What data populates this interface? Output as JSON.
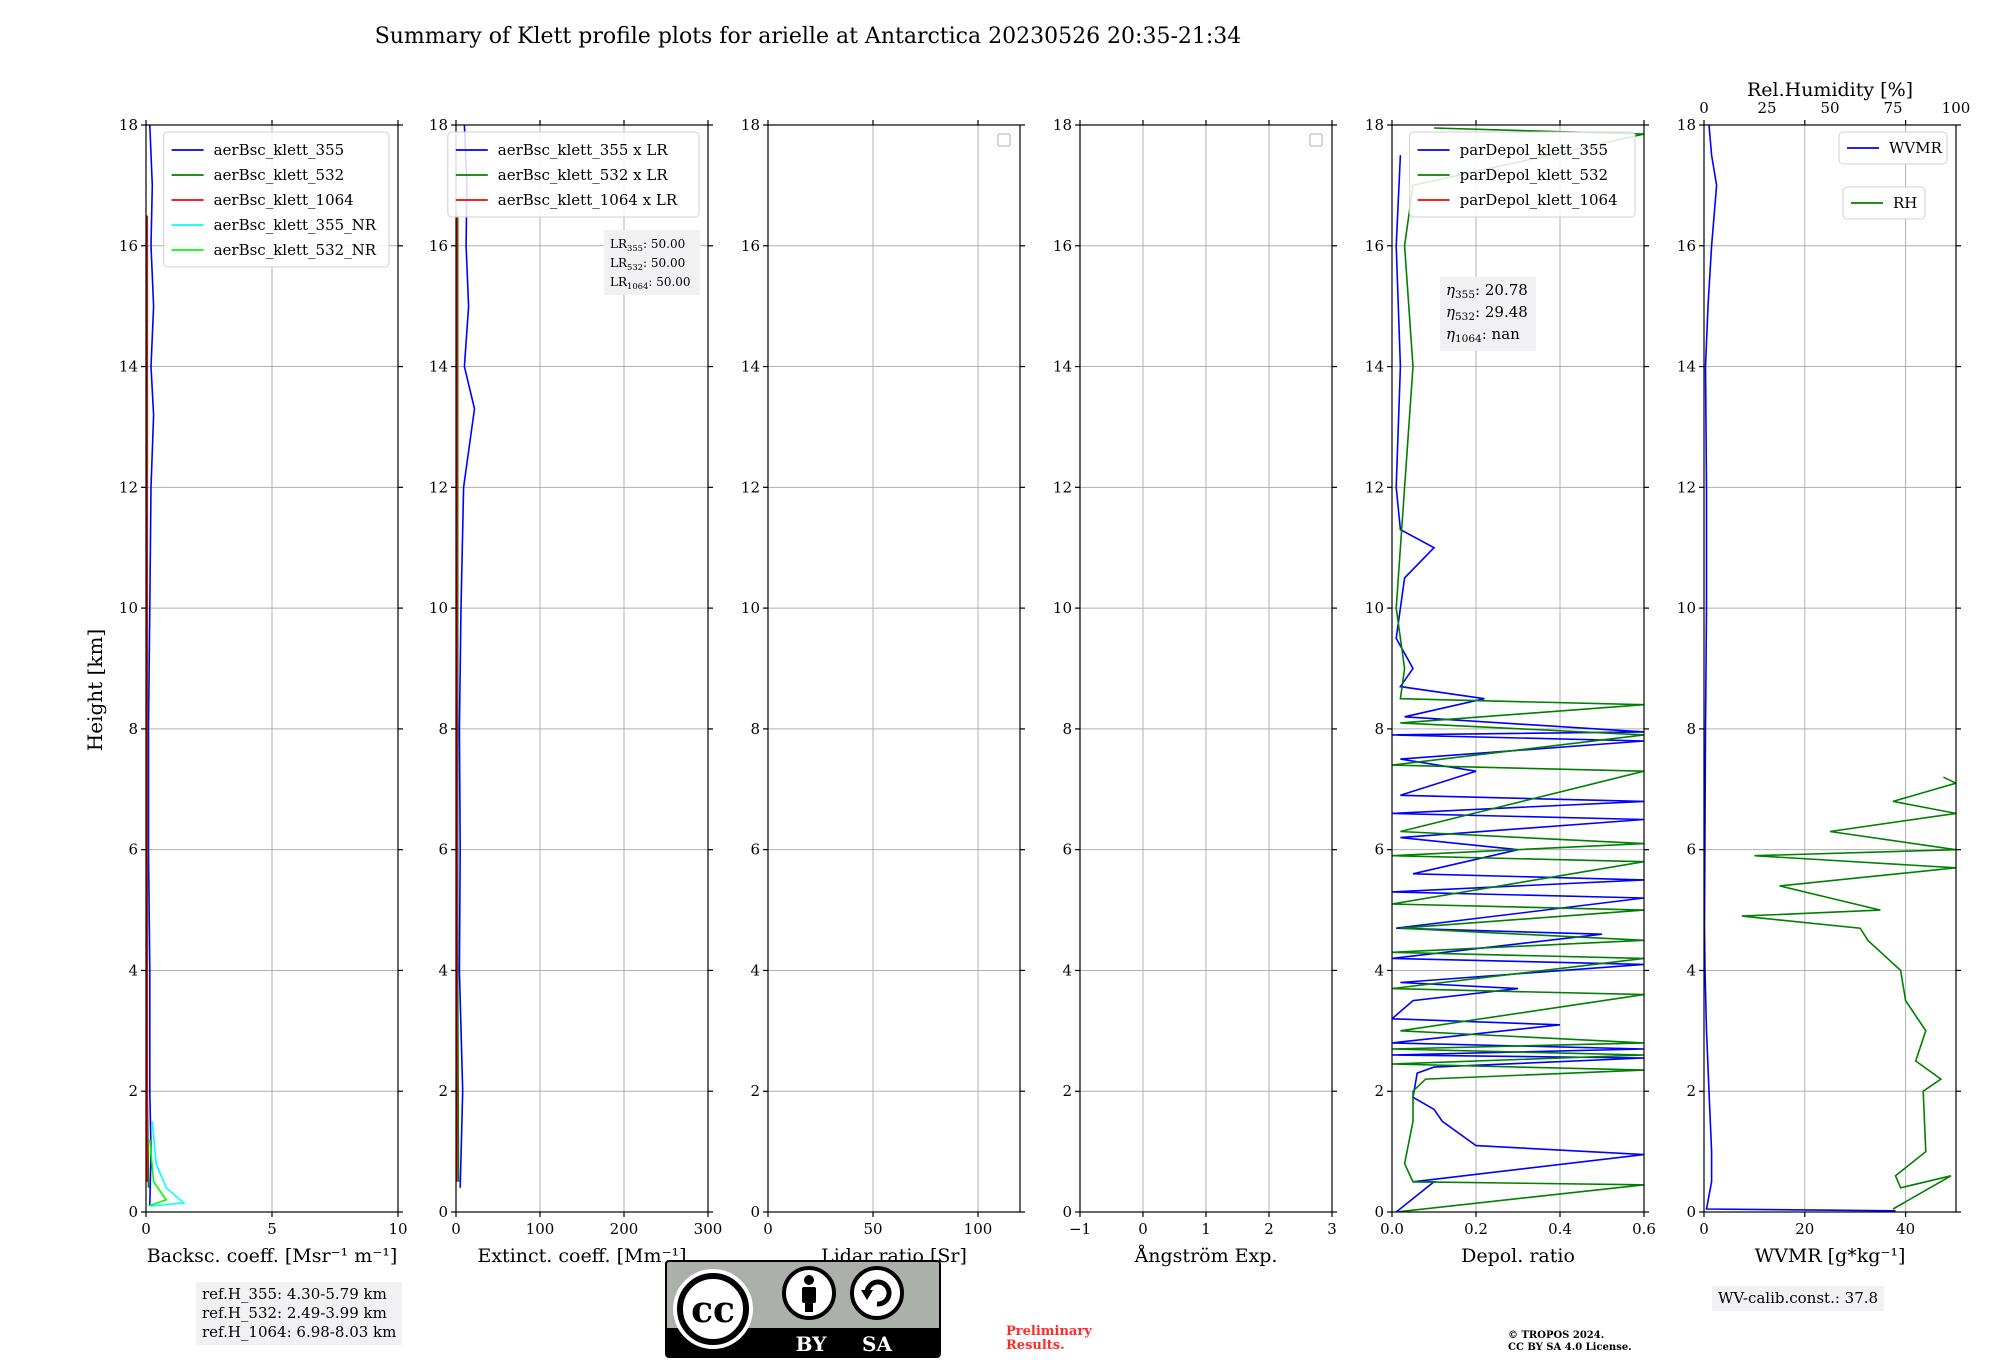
{
  "title": "Summary of Klett profile plots for arielle at Antarctica 20230526 20:35-21:34",
  "y_label": "Height [km]",
  "y_ticks": [
    "0",
    "2",
    "4",
    "6",
    "8",
    "10",
    "12",
    "14",
    "16",
    "18"
  ],
  "footer": {
    "preliminary": "Preliminary\nResults.",
    "license": "© TROPOS 2024.\nCC BY SA 4.0 License.",
    "cc_badge": {
      "by": "BY",
      "sa": "SA",
      "cc": "cc"
    }
  },
  "colors": {
    "c355": "#0000ff",
    "c532": "#008000",
    "c1064": "#ff0000",
    "c355nr": "#00ffff",
    "c532nr": "#00ff00"
  },
  "chart_data": [
    {
      "type": "line",
      "id": "backscatter",
      "xlabel": "Backsc. coeff. [Msr⁻¹ m⁻¹]",
      "xlim": [
        0,
        10
      ],
      "xticks": [
        "0",
        "5",
        "10"
      ],
      "ylim": [
        0,
        18
      ],
      "legend": {
        "placement": "upper right",
        "entries": [
          "aerBsc_klett_355",
          "aerBsc_klett_532",
          "aerBsc_klett_1064",
          "aerBsc_klett_355_NR",
          "aerBsc_klett_532_NR"
        ]
      },
      "series": [
        {
          "name": "aerBsc_klett_355",
          "color": "#0000ff",
          "points": [
            [
              0.15,
              0.1
            ],
            [
              0.2,
              1.0
            ],
            [
              0.15,
              2.0
            ],
            [
              0.15,
              4.0
            ],
            [
              0.1,
              6.0
            ],
            [
              0.1,
              8.0
            ],
            [
              0.15,
              10.0
            ],
            [
              0.2,
              12.0
            ],
            [
              0.3,
              13.2
            ],
            [
              0.2,
              14.0
            ],
            [
              0.3,
              15.0
            ],
            [
              0.2,
              16.0
            ],
            [
              0.25,
              17.0
            ],
            [
              0.15,
              18.0
            ]
          ]
        },
        {
          "name": "aerBsc_klett_532",
          "color": "#008000",
          "points": [
            [
              0.1,
              0.4
            ],
            [
              0.05,
              2.0
            ],
            [
              0.05,
              6.0
            ],
            [
              0.05,
              10.0
            ],
            [
              0.05,
              14.0
            ],
            [
              0.05,
              16.5
            ]
          ]
        },
        {
          "name": "aerBsc_klett_1064",
          "color": "#ff0000",
          "points": [
            [
              0.05,
              0.5
            ],
            [
              0.03,
              4.0
            ],
            [
              0.03,
              10.0
            ],
            [
              0.03,
              16.5
            ]
          ]
        },
        {
          "name": "aerBsc_klett_355_NR",
          "color": "#00ffff",
          "points": [
            [
              0.2,
              0.1
            ],
            [
              1.5,
              0.15
            ],
            [
              0.8,
              0.4
            ],
            [
              0.4,
              0.8
            ],
            [
              0.25,
              1.5
            ]
          ]
        },
        {
          "name": "aerBsc_klett_532_NR",
          "color": "#00ff00",
          "points": [
            [
              0.1,
              0.1
            ],
            [
              0.8,
              0.2
            ],
            [
              0.3,
              0.5
            ],
            [
              0.15,
              1.2
            ]
          ]
        }
      ]
    },
    {
      "type": "line",
      "id": "extinction",
      "xlabel": "Extinct. coeff. [Mm⁻¹]",
      "xlim": [
        0,
        300
      ],
      "xticks": [
        "0",
        "100",
        "200",
        "300"
      ],
      "ylim": [
        0,
        18
      ],
      "legend": {
        "placement": "upper right",
        "entries": [
          "aerBsc_klett_355 x LR",
          "aerBsc_klett_532 x LR",
          "aerBsc_klett_1064 x LR"
        ]
      },
      "annotation": {
        "lines": [
          [
            "LR",
            "355",
            ": 50.00"
          ],
          [
            "LR",
            "532",
            ": 50.00"
          ],
          [
            "LR",
            "1064",
            ": 50.00"
          ]
        ]
      },
      "series": [
        {
          "name": "aerBsc_klett_355 x LR",
          "color": "#0000ff",
          "points": [
            [
              5,
              0.4
            ],
            [
              8,
              2.0
            ],
            [
              4,
              4.0
            ],
            [
              5,
              6.0
            ],
            [
              4,
              8.0
            ],
            [
              6,
              10.0
            ],
            [
              9,
              12.0
            ],
            [
              22,
              13.3
            ],
            [
              10,
              14.0
            ],
            [
              15,
              15.0
            ],
            [
              12,
              16.0
            ],
            [
              13,
              17.0
            ],
            [
              10,
              18.0
            ]
          ]
        },
        {
          "name": "aerBsc_klett_532 x LR",
          "color": "#008000",
          "points": [
            [
              3,
              0.5
            ],
            [
              2,
              4.0
            ],
            [
              2,
              10.0
            ],
            [
              2,
              16.5
            ]
          ]
        },
        {
          "name": "aerBsc_klett_1064 x LR",
          "color": "#ff0000",
          "points": [
            [
              1,
              0.5
            ],
            [
              1,
              10.0
            ],
            [
              1,
              16.5
            ]
          ]
        }
      ]
    },
    {
      "type": "line",
      "id": "lidar_ratio",
      "xlabel": "Lidar ratio [Sr]",
      "xlim": [
        0,
        120
      ],
      "xticks": [
        "0",
        "50",
        "100"
      ],
      "ylim": [
        0,
        18
      ],
      "legend": {
        "placement": "upper right",
        "entries": []
      },
      "series": []
    },
    {
      "type": "line",
      "id": "angstrom",
      "xlabel": "Ångström Exp.",
      "xlim": [
        -1,
        3
      ],
      "xticks": [
        "−1",
        "0",
        "1",
        "2",
        "3"
      ],
      "ylim": [
        0,
        18
      ],
      "legend": {
        "placement": "upper right",
        "entries": []
      },
      "series": []
    },
    {
      "type": "line",
      "id": "depol",
      "xlabel": "Depol. ratio",
      "xlim": [
        0,
        0.6
      ],
      "xticks": [
        "0.0",
        "0.2",
        "0.4",
        "0.6"
      ],
      "ylim": [
        0,
        18
      ],
      "legend": {
        "placement": "upper right",
        "entries": [
          "parDepol_klett_355",
          "parDepol_klett_532",
          "parDepol_klett_1064"
        ]
      },
      "annotation": {
        "lines": [
          [
            "η",
            "355",
            ": 20.78"
          ],
          [
            "η",
            "532",
            ": 29.48"
          ],
          [
            "η",
            "1064",
            ": nan"
          ]
        ]
      },
      "series": [
        {
          "name": "parDepol_klett_355",
          "color": "#0000ff",
          "points": [
            [
              0.01,
              0.0
            ],
            [
              0.1,
              0.5
            ],
            [
              0.05,
              0.5
            ],
            [
              0.6,
              0.95
            ],
            [
              0.2,
              1.1
            ],
            [
              0.12,
              1.5
            ],
            [
              0.1,
              1.7
            ],
            [
              0.05,
              1.9
            ],
            [
              0.06,
              2.3
            ],
            [
              0.1,
              2.4
            ],
            [
              0.6,
              2.55
            ],
            [
              0.0,
              2.6
            ],
            [
              0.6,
              2.7
            ],
            [
              0.0,
              2.8
            ],
            [
              0.4,
              3.1
            ],
            [
              0.0,
              3.2
            ],
            [
              0.05,
              3.5
            ],
            [
              0.3,
              3.7
            ],
            [
              0.02,
              3.8
            ],
            [
              0.6,
              4.1
            ],
            [
              0.0,
              4.2
            ],
            [
              0.5,
              4.6
            ],
            [
              0.01,
              4.7
            ],
            [
              0.6,
              5.2
            ],
            [
              0.0,
              5.3
            ],
            [
              0.6,
              5.5
            ],
            [
              0.05,
              5.6
            ],
            [
              0.3,
              6.0
            ],
            [
              0.02,
              6.2
            ],
            [
              0.6,
              6.5
            ],
            [
              0.0,
              6.6
            ],
            [
              0.6,
              6.8
            ],
            [
              0.02,
              6.9
            ],
            [
              0.2,
              7.3
            ],
            [
              0.02,
              7.5
            ],
            [
              0.6,
              7.8
            ],
            [
              0.0,
              7.9
            ],
            [
              0.6,
              7.95
            ],
            [
              0.03,
              8.2
            ],
            [
              0.22,
              8.5
            ],
            [
              0.02,
              8.7
            ],
            [
              0.05,
              9.0
            ],
            [
              0.01,
              9.5
            ],
            [
              0.03,
              10.5
            ],
            [
              0.1,
              11.0
            ],
            [
              0.02,
              11.3
            ],
            [
              0.01,
              12.0
            ],
            [
              0.02,
              14.0
            ],
            [
              0.01,
              16.0
            ],
            [
              0.02,
              17.5
            ]
          ]
        },
        {
          "name": "parDepol_klett_532",
          "color": "#008000",
          "points": [
            [
              0.01,
              0.0
            ],
            [
              0.6,
              0.45
            ],
            [
              0.05,
              0.5
            ],
            [
              0.03,
              0.8
            ],
            [
              0.05,
              1.5
            ],
            [
              0.05,
              2.0
            ],
            [
              0.08,
              2.2
            ],
            [
              0.6,
              2.35
            ],
            [
              0.0,
              2.45
            ],
            [
              0.6,
              2.6
            ],
            [
              0.0,
              2.7
            ],
            [
              0.6,
              2.8
            ],
            [
              0.02,
              3.0
            ],
            [
              0.6,
              3.6
            ],
            [
              0.0,
              3.7
            ],
            [
              0.6,
              4.2
            ],
            [
              0.0,
              4.3
            ],
            [
              0.6,
              4.5
            ],
            [
              0.02,
              4.7
            ],
            [
              0.6,
              5.0
            ],
            [
              0.0,
              5.1
            ],
            [
              0.6,
              5.8
            ],
            [
              0.0,
              5.9
            ],
            [
              0.6,
              6.1
            ],
            [
              0.02,
              6.3
            ],
            [
              0.6,
              7.3
            ],
            [
              0.0,
              7.4
            ],
            [
              0.6,
              7.9
            ],
            [
              0.02,
              8.1
            ],
            [
              0.6,
              8.4
            ],
            [
              0.02,
              8.5
            ],
            [
              0.03,
              9.0
            ],
            [
              0.01,
              10.0
            ],
            [
              0.02,
              11.0
            ],
            [
              0.03,
              12.0
            ],
            [
              0.05,
              14.0
            ],
            [
              0.04,
              15.0
            ],
            [
              0.03,
              16.0
            ],
            [
              0.05,
              17.0
            ],
            [
              0.6,
              17.85
            ],
            [
              0.1,
              17.95
            ]
          ]
        },
        {
          "name": "parDepol_klett_1064",
          "color": "#ff0000",
          "points": []
        }
      ]
    },
    {
      "type": "line",
      "id": "water_vapor",
      "xlabel": "WVMR [g*kg⁻¹]",
      "xlim": [
        0,
        50
      ],
      "xticks": [
        "0",
        "20",
        "40"
      ],
      "x2label": "Rel.Humidity [%]",
      "x2lim": [
        0,
        100
      ],
      "x2ticks": [
        "0",
        "25",
        "50",
        "75",
        "100"
      ],
      "ylim": [
        0,
        18
      ],
      "legend": {
        "placement": "upper right",
        "entries": [
          "WVMR",
          "RH"
        ]
      },
      "annotation_text": "WV-calib.const.: 37.8",
      "series": [
        {
          "name": "WVMR",
          "color": "#0000ff",
          "points": [
            [
              38,
              0.02
            ],
            [
              0.5,
              0.05
            ],
            [
              1.5,
              0.5
            ],
            [
              1.5,
              1.0
            ],
            [
              1.0,
              2.0
            ],
            [
              0.5,
              3.0
            ],
            [
              0.2,
              4.0
            ],
            [
              0.1,
              4.7
            ],
            [
              0.3,
              8.0
            ],
            [
              0.5,
              10.0
            ],
            [
              0.5,
              12.0
            ],
            [
              0.4,
              13.0
            ],
            [
              0.3,
              14.0
            ],
            [
              0.8,
              15.0
            ],
            [
              1.5,
              16.0
            ],
            [
              2.5,
              17.0
            ],
            [
              1.5,
              17.5
            ],
            [
              1.0,
              18.0
            ]
          ]
        },
        {
          "name": "RH",
          "color": "#008000",
          "points": [
            [
              75,
              0.05
            ],
            [
              98,
              0.6
            ],
            [
              78,
              0.4
            ],
            [
              76,
              0.6
            ],
            [
              88,
              1.0
            ],
            [
              87,
              2.0
            ],
            [
              94,
              2.2
            ],
            [
              84,
              2.5
            ],
            [
              88,
              3.0
            ],
            [
              80,
              3.5
            ],
            [
              78,
              4.0
            ],
            [
              65,
              4.5
            ],
            [
              62,
              4.7
            ],
            [
              15,
              4.9
            ],
            [
              70,
              5.0
            ],
            [
              30,
              5.4
            ],
            [
              100,
              5.7
            ],
            [
              20,
              5.9
            ],
            [
              100,
              6.0
            ],
            [
              50,
              6.3
            ],
            [
              100,
              6.6
            ],
            [
              75,
              6.8
            ],
            [
              100,
              7.1
            ],
            [
              95,
              7.2
            ]
          ]
        }
      ]
    }
  ],
  "ref_box": [
    "ref.H_355: 4.30-5.79 km",
    "ref.H_532: 2.49-3.99 km",
    "ref.H_1064: 6.98-8.03 km"
  ]
}
